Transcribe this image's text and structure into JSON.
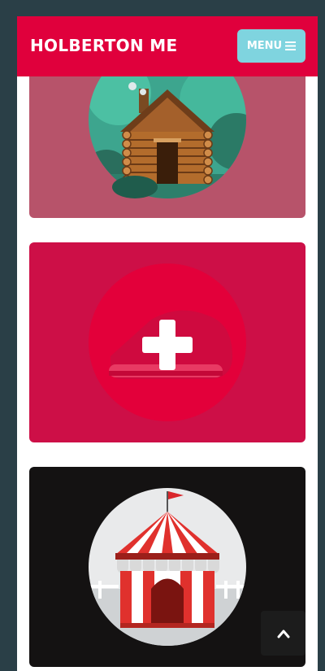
{
  "header": {
    "brand": "HOLBERTON ME",
    "menu_label": "MENU",
    "menu_icon": "hamburger-icon"
  },
  "cards": [
    {
      "illustration": "log-cabin-icon",
      "background": "#b7536a"
    },
    {
      "illustration": "add-plus-icon",
      "background": "#cd0f47"
    },
    {
      "illustration": "circus-tent-icon",
      "background": "#141212"
    }
  ],
  "back_to_top": {
    "icon": "chevron-up-icon"
  },
  "colors": {
    "page_background": "#2a3f47",
    "header": "#e0003c",
    "menu_button": "#7fd4df"
  }
}
